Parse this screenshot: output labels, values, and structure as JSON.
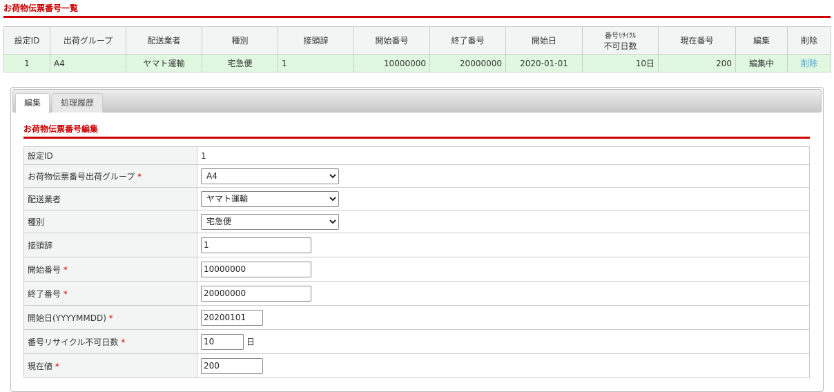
{
  "page_title": "お荷物伝票番号一覧",
  "list": {
    "headers": [
      "設定ID",
      "出荷グループ",
      "配送業者",
      "種別",
      "接頭辞",
      "開始番号",
      "終了番号",
      "開始日",
      "番号ﾘｻｲｸﾙ",
      "不可日数",
      "現在番号",
      "編集",
      "削除"
    ],
    "row": {
      "id": "1",
      "group": "A4",
      "carrier": "ヤマト運輸",
      "type": "宅急便",
      "prefix": "1",
      "start": "10000000",
      "end": "20000000",
      "start_date": "2020-01-01",
      "recycle": "10日",
      "current": "200",
      "edit": "編集中",
      "delete": "削除"
    }
  },
  "tabs": [
    "編集",
    "処理履歴"
  ],
  "form": {
    "title": "お荷物伝票番号編集",
    "required_mark": "*",
    "labels": [
      "設定ID",
      "お荷物伝票番号出荷グループ",
      "配送業者",
      "種別",
      "接頭辞",
      "開始番号",
      "終了番号",
      "開始日(YYYYMMDD)",
      "番号リサイクル不可日数",
      "現在値"
    ],
    "id": "1",
    "group": "A4",
    "carrier": "ヤマト運輸",
    "type": "宅急便",
    "prefix": "1",
    "start": "10000000",
    "end": "20000000",
    "start_date": "20200101",
    "recycle": "10",
    "recycle_unit": "日",
    "current": "200"
  }
}
